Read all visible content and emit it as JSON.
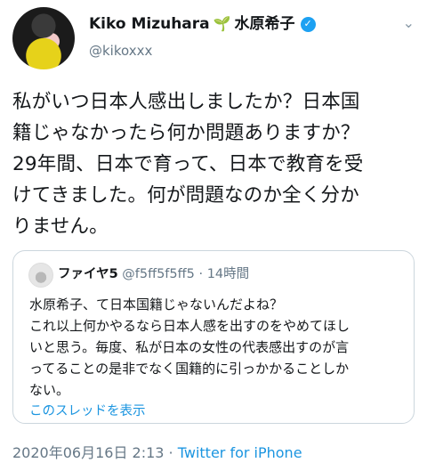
{
  "author": {
    "display_name": "Kiko Mizuhara",
    "kanji_name": "水原希子",
    "handle": "@kikoxxx",
    "sprout_emoji": "🌱",
    "verified_icon": "✓"
  },
  "menu_icon": "⌄",
  "tweet": {
    "text": "私がいつ日本人感出しましたか？日本国\n籍じゃなかったら何か問題ありますか？\n29年間、日本で育って、日本で教育を受\nけてきました。何が問題なのか全く分か\nりません。"
  },
  "quote": {
    "name": "ファイヤ5",
    "handle": "@f5ff5f5ff5",
    "time": "14時間",
    "separator": "·",
    "text": "水原希子、て日本国籍じゃないんだよね？\nこれ以上何かやるなら日本人感を出すのをやめてほし\nいと思う。毎度、私が日本の女性の代表感出すのが言\nってることの是非でなく国籍的に引っかかることしか\nない。",
    "thread_link": "このスレッドを表示"
  },
  "footer": {
    "timestamp": "2020年06月16日 2:13",
    "separator": " · ",
    "app": "Twitter for iPhone"
  },
  "colors": {
    "link": "#1b95e0",
    "muted": "#657786",
    "verified": "#1da1f2"
  }
}
